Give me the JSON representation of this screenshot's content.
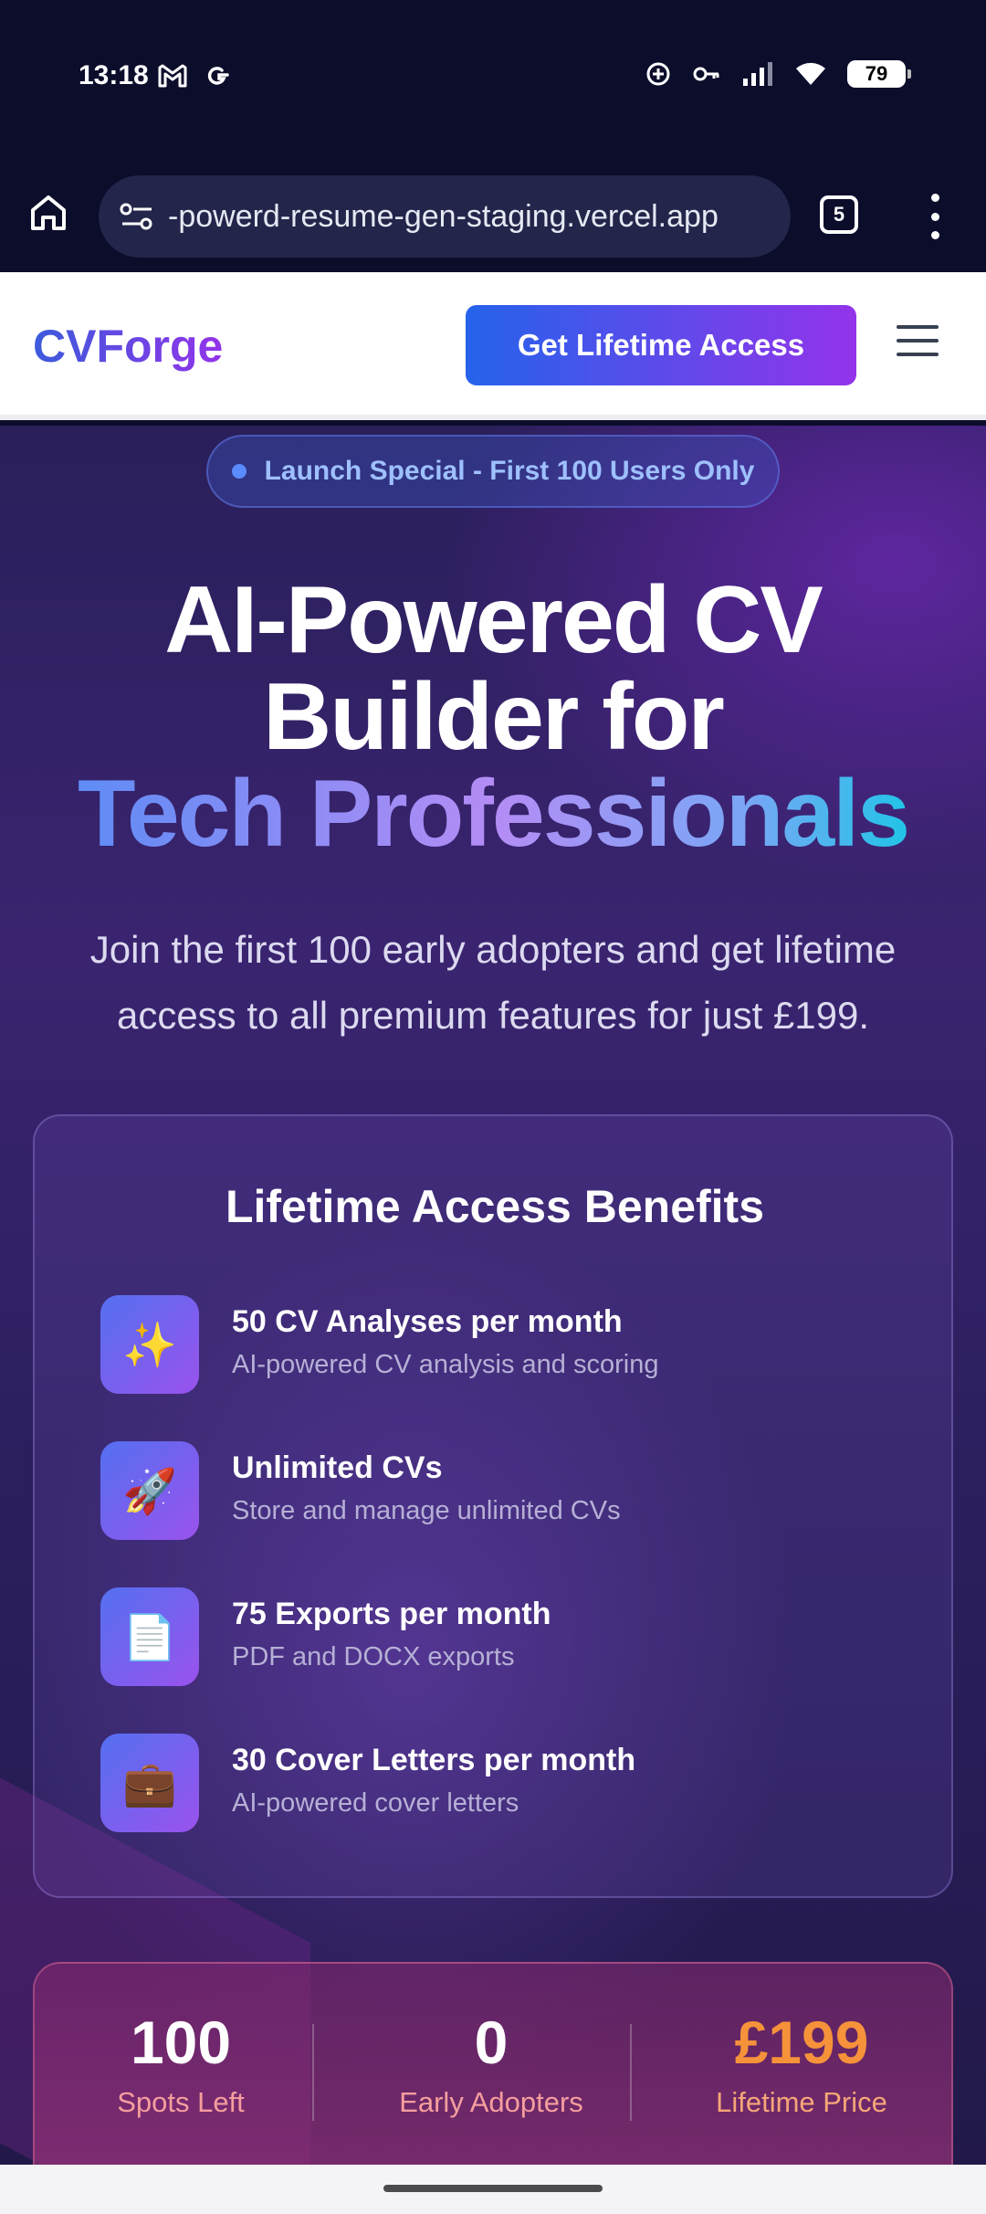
{
  "status_bar": {
    "time": "13:18",
    "left_icons": [
      "gmail-icon",
      "google-icon"
    ],
    "right_icons": [
      "data-saver-icon",
      "vpn-key-icon",
      "signal-icon",
      "wifi-icon"
    ],
    "battery": "79"
  },
  "browser": {
    "url": "-powerd-resume-gen-staging.vercel.app",
    "tab_count": "5"
  },
  "header": {
    "logo": "CVForge",
    "cta_label": "Get Lifetime Access"
  },
  "hero": {
    "badge": "Launch Special - First 100 Users Only",
    "title_line1": "AI-Powered CV",
    "title_line2": "Builder for",
    "title_line3": "Tech Professionals",
    "subtitle": "Join the first 100 early adopters and get lifetime access to all premium features for just £199."
  },
  "benefits": {
    "title": "Lifetime Access Benefits",
    "items": [
      {
        "icon": "✨",
        "title": "50 CV Analyses per month",
        "desc": "AI-powered CV analysis and scoring"
      },
      {
        "icon": "🚀",
        "title": "Unlimited CVs",
        "desc": "Store and manage unlimited CVs"
      },
      {
        "icon": "📄",
        "title": "75 Exports per month",
        "desc": "PDF and DOCX exports"
      },
      {
        "icon": "💼",
        "title": "30 Cover Letters per month",
        "desc": "AI-powered cover letters"
      }
    ]
  },
  "stats": {
    "spots_value": "100",
    "spots_label": "Spots Left",
    "adopters_value": "0",
    "adopters_label": "Early Adopters",
    "price_value": "£199",
    "price_label": "Lifetime Price"
  },
  "colors": {
    "accent_blue": "#2563eb",
    "accent_purple": "#9333ea",
    "price_orange": "#f5923a"
  }
}
